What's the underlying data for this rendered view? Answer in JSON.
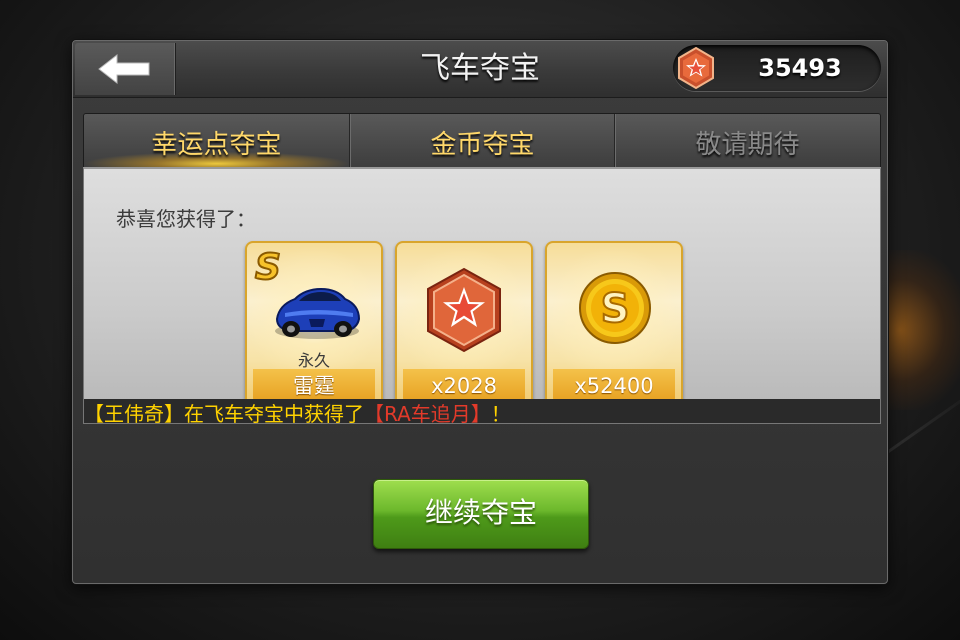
{
  "header": {
    "title": "飞车夺宝",
    "coin_amount": "35493",
    "back_icon": "back-arrow-icon",
    "currency_icon": "red-star-badge-icon"
  },
  "tabs": [
    {
      "label": "幸运点夺宝",
      "state": "active"
    },
    {
      "label": "金币夺宝",
      "state": "normal"
    },
    {
      "label": "敬请期待",
      "state": "disabled"
    }
  ],
  "content": {
    "congrats_text": "恭喜您获得了：",
    "rewards": [
      {
        "icon": "blue-race-car-icon",
        "badge": "S",
        "sub": "永久",
        "label": "雷霆"
      },
      {
        "icon": "red-star-badge-icon",
        "label": "x2028"
      },
      {
        "icon": "gold-coin-icon",
        "label": "x52400"
      }
    ],
    "ticker": {
      "before": "【王伟奇】在飞车夺宝中获得了",
      "highlight": "【RA车追月】",
      "after": "！"
    }
  },
  "actions": {
    "continue_label": "继续夺宝"
  },
  "colors": {
    "tab_active": "#ffd86a",
    "tab_disabled": "#8a8a8a",
    "ticker_text": "#ffd200",
    "ticker_highlight": "#e23a2a",
    "button_green": "#6cb82c"
  }
}
